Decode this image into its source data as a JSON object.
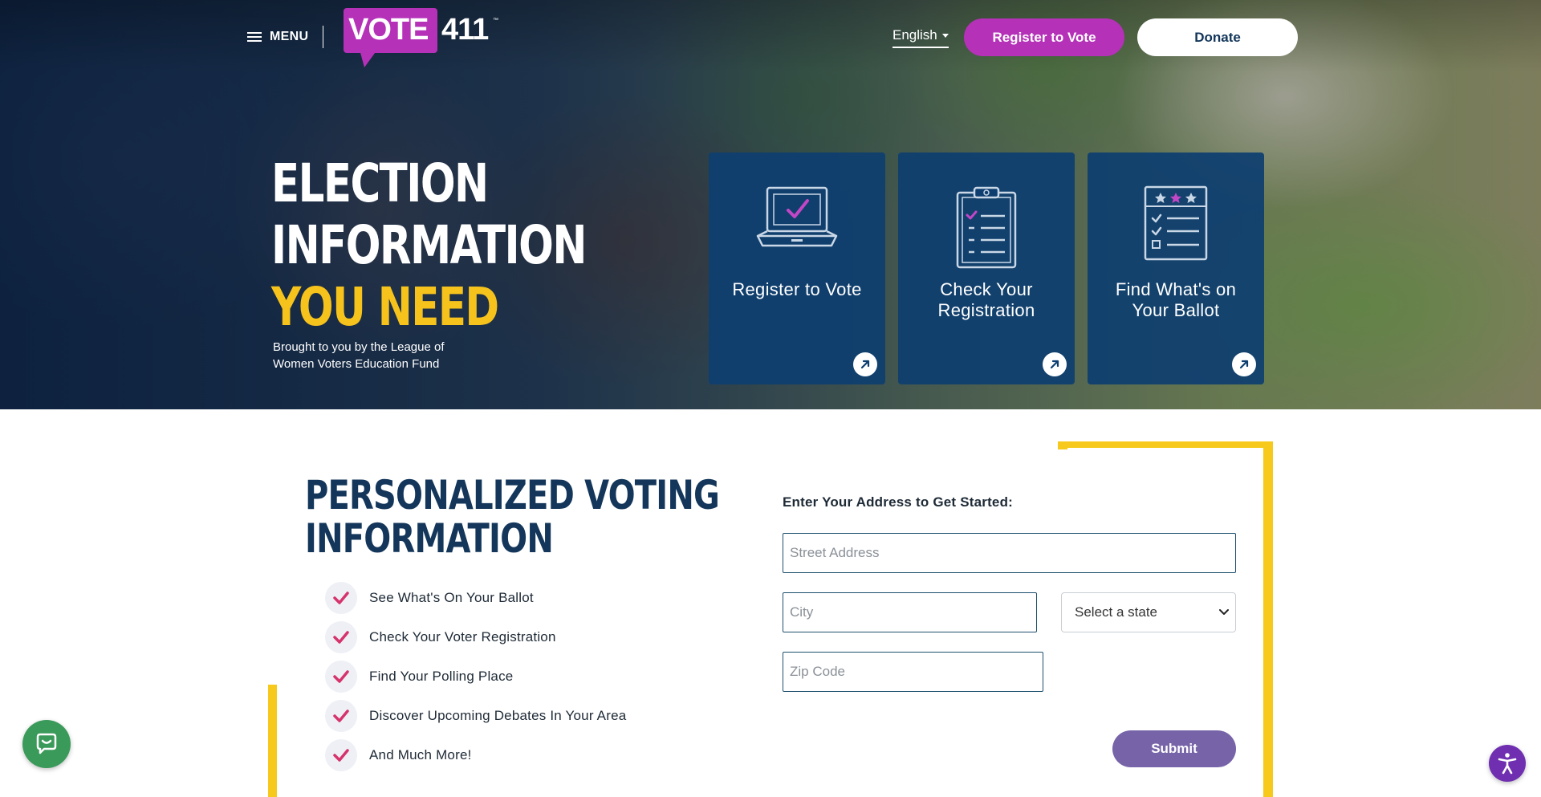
{
  "header": {
    "menu_label": "MENU",
    "logo": {
      "vote": "VOTE",
      "number": "411",
      "tm": "™"
    },
    "language": "English",
    "register_button": "Register to Vote",
    "donate_button": "Donate"
  },
  "hero": {
    "title_line1": "ELECTION",
    "title_line2": "INFORMATION",
    "title_line3": "YOU NEED",
    "subtitle": "Brought to you by the League of Women Voters Education Fund",
    "tiles": [
      {
        "label": "Register to Vote",
        "icon": "laptop-check-icon"
      },
      {
        "label": "Check Your Registration",
        "icon": "clipboard-checklist-icon"
      },
      {
        "label": "Find What's on Your Ballot",
        "icon": "ballot-list-icon"
      }
    ]
  },
  "main": {
    "title_line1": "PERSONALIZED VOTING",
    "title_line2": "INFORMATION",
    "benefits": [
      "See What's On Your Ballot",
      "Check Your Voter Registration",
      "Find Your Polling Place",
      "Discover Upcoming Debates In Your Area",
      "And Much More!"
    ]
  },
  "form": {
    "heading": "Enter Your Address to Get Started:",
    "street_placeholder": "Street Address",
    "city_placeholder": "City",
    "state_selected": "Select a state",
    "zip_placeholder": "Zip Code",
    "submit_label": "Submit"
  },
  "widgets": {
    "chat": "chat-icon",
    "accessibility": "accessibility-icon"
  },
  "colors": {
    "brand_purple": "#b531b8",
    "navy": "#13365a",
    "tile_blue": "#0e3e70",
    "accent_yellow": "#f6c21c",
    "check_pink": "#d6336c",
    "submit_purple": "#7663a8",
    "chat_green": "#3a9a5a",
    "a11y_purple": "#6f2fb0"
  }
}
